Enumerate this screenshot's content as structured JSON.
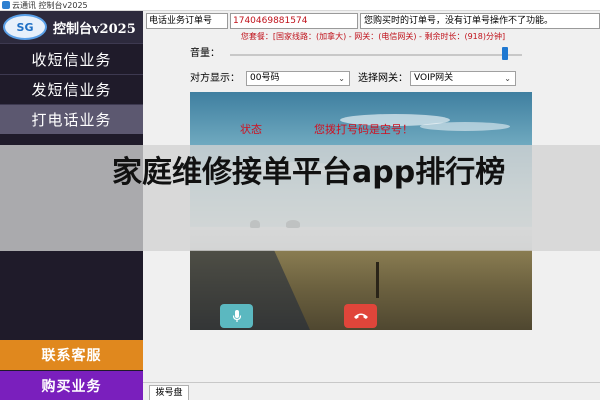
{
  "window": {
    "title": "云通讯 控制台v2025"
  },
  "sidebar": {
    "logo_badge": "SG",
    "logo_text": "控制台v2025",
    "items": [
      {
        "label": "收短信业务"
      },
      {
        "label": "发短信业务"
      },
      {
        "label": "打电话业务"
      }
    ],
    "contact_label": "联系客服",
    "buy_label": "购买业务"
  },
  "order": {
    "label": "电话业务订单号",
    "value": "1740469881574",
    "hint": "您购买时的订单号，没有订单号操作不了功能。"
  },
  "package_info": "您套餐：[国家线路：(加拿大) - 网关：(电信网关) - 剩余时长：(918)分钟]",
  "volume": {
    "label": "音量：",
    "level": 0.95
  },
  "caller_display": {
    "label": "对方显示：",
    "selected": "00号码"
  },
  "gateway": {
    "label": "选择网关：",
    "selected": "VOIP网关"
  },
  "call_panel": {
    "status_label": "状态",
    "status_message": "您拨打号码是空号！"
  },
  "tabs": {
    "dialpad": "拨号盘"
  },
  "overlay": {
    "text": "家庭维修接单平台app排行榜"
  },
  "colors": {
    "sidebar_bg": "#1f1b2a",
    "contact_bg": "#e0881e",
    "buy_bg": "#7a1fbd",
    "alert_red": "#d01020",
    "hangup_red": "#e0453a",
    "mic_teal": "#5bb8c0"
  },
  "icons": {
    "mic": "microphone-icon",
    "hangup": "phone-hangup-icon",
    "select": "chevron-down-icon"
  }
}
